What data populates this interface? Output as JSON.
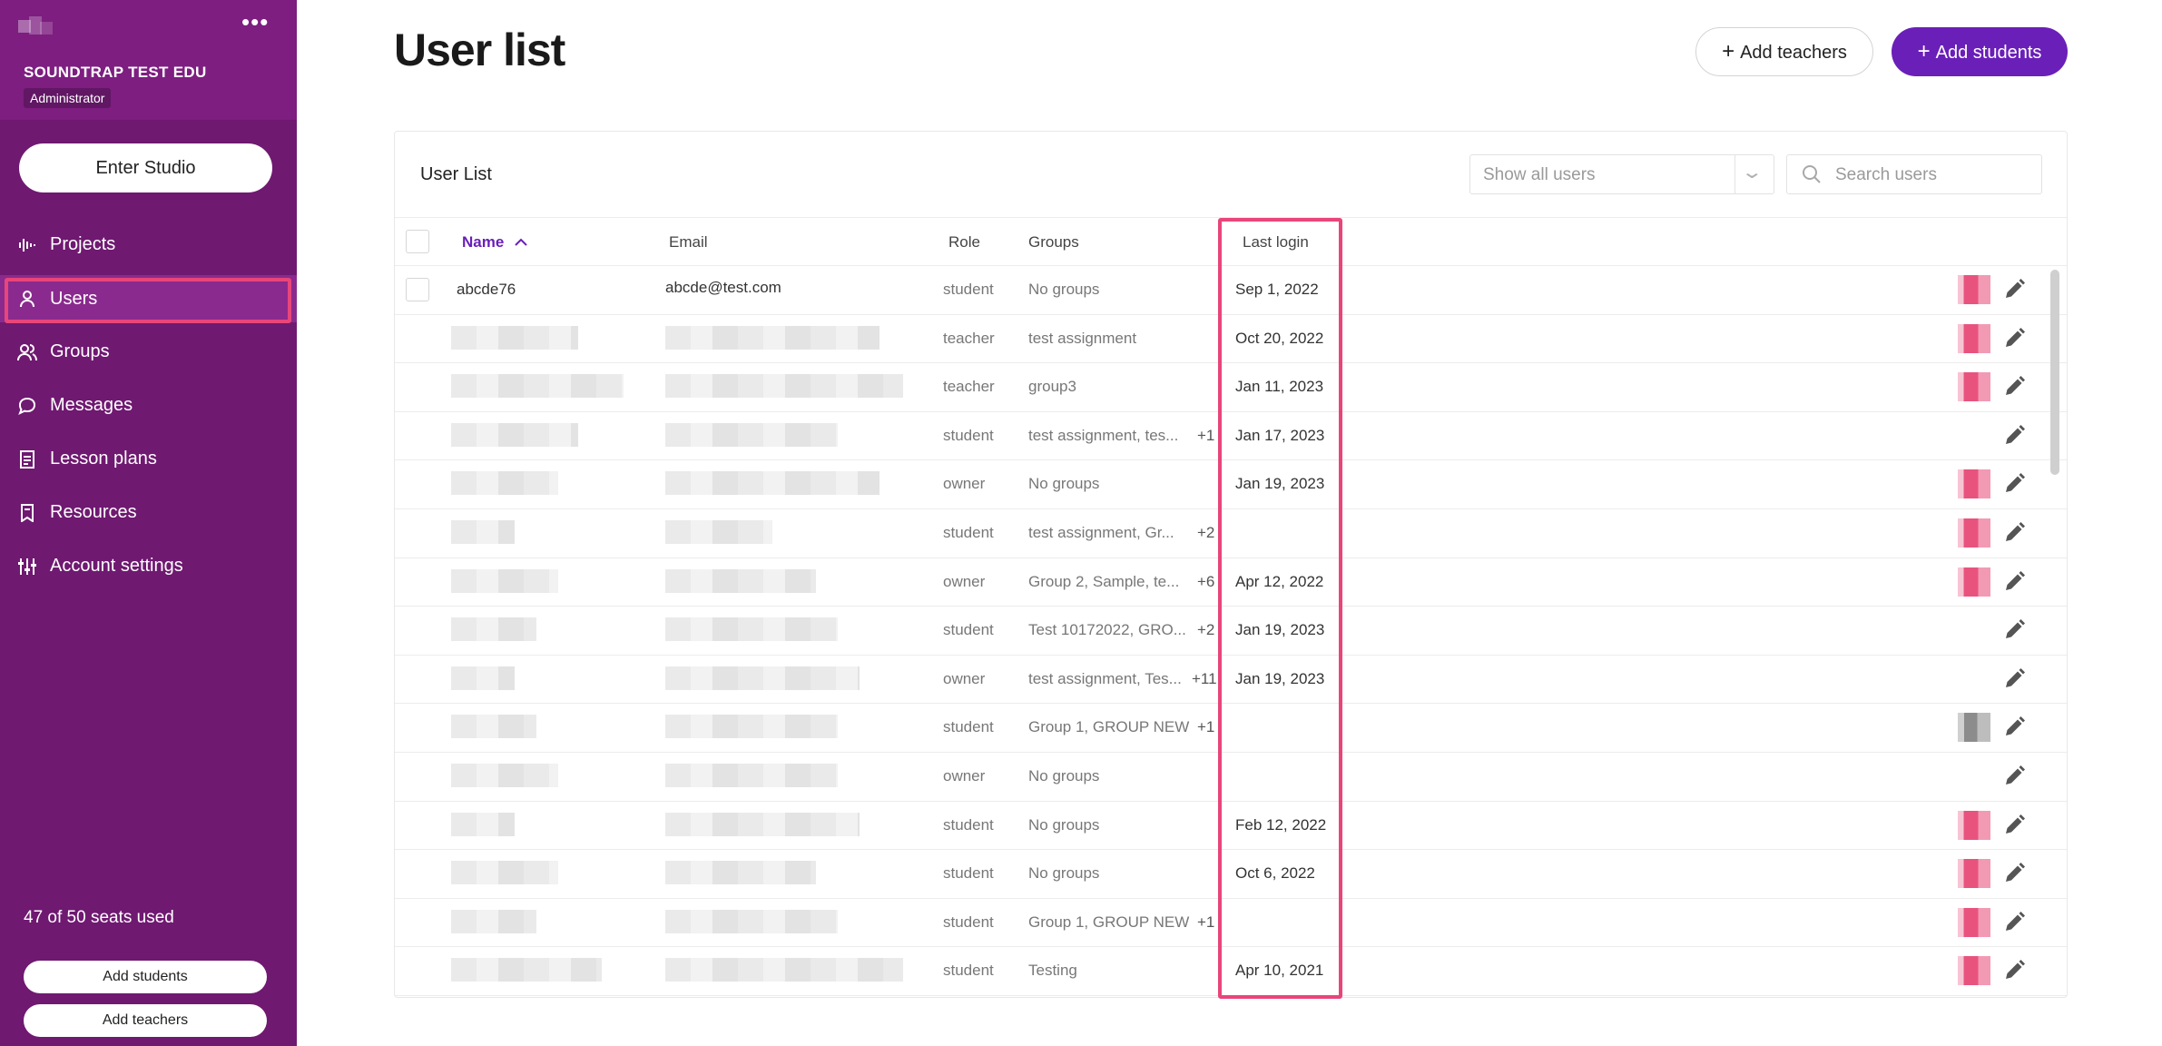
{
  "sidebar": {
    "org_name": "SOUNDTRAP TEST EDU",
    "role": "Administrator",
    "enter_studio": "Enter Studio",
    "nav": [
      {
        "label": "Projects",
        "icon": "bars-icon"
      },
      {
        "label": "Users",
        "icon": "user-icon",
        "active": true
      },
      {
        "label": "Groups",
        "icon": "group-icon"
      },
      {
        "label": "Messages",
        "icon": "chat-icon"
      },
      {
        "label": "Lesson plans",
        "icon": "document-icon"
      },
      {
        "label": "Resources",
        "icon": "bookmark-icon"
      },
      {
        "label": "Account settings",
        "icon": "sliders-icon"
      }
    ],
    "seats": "47 of 50 seats used",
    "add_students": "Add students",
    "add_teachers": "Add teachers"
  },
  "header": {
    "title": "User list",
    "add_teachers": "Add teachers",
    "add_students": "Add students"
  },
  "card": {
    "title": "User List",
    "filter": "Show all users",
    "search_placeholder": "Search users"
  },
  "table": {
    "columns": {
      "name": "Name",
      "email": "Email",
      "role": "Role",
      "groups": "Groups",
      "last_login": "Last login"
    },
    "rows": [
      {
        "name": "abcde76",
        "email": "abcde@test.com",
        "role": "student",
        "groups": "No groups",
        "more": "",
        "last_login": "Sep 1, 2022",
        "avatar": "pink"
      },
      {
        "name": "",
        "email": "",
        "role": "teacher",
        "groups": "test assignment",
        "more": "",
        "last_login": "Oct 20, 2022",
        "avatar": "pink"
      },
      {
        "name": "",
        "email": "",
        "role": "teacher",
        "groups": "group3",
        "more": "",
        "last_login": "Jan 11, 2023",
        "avatar": "pink"
      },
      {
        "name": "",
        "email": "",
        "role": "student",
        "groups": "test assignment, tes...",
        "more": "+1",
        "last_login": "Jan 17, 2023",
        "avatar": ""
      },
      {
        "name": "",
        "email": "",
        "role": "owner",
        "groups": "No groups",
        "more": "",
        "last_login": "Jan 19, 2023",
        "avatar": "pink"
      },
      {
        "name": "",
        "email": "",
        "role": "student",
        "groups": "test assignment, Gr...",
        "more": "+2",
        "last_login": "",
        "avatar": "pink"
      },
      {
        "name": "",
        "email": "",
        "role": "owner",
        "groups": "Group 2, Sample, te...",
        "more": "+6",
        "last_login": "Apr 12, 2022",
        "avatar": "pink"
      },
      {
        "name": "",
        "email": "",
        "role": "student",
        "groups": "Test 10172022, GRO...",
        "more": "+2",
        "last_login": "Jan 19, 2023",
        "avatar": ""
      },
      {
        "name": "",
        "email": "",
        "role": "owner",
        "groups": "test assignment, Tes...",
        "more": "+11",
        "last_login": "Jan 19, 2023",
        "avatar": ""
      },
      {
        "name": "",
        "email": "",
        "role": "student",
        "groups": "Group 1, GROUP NEW",
        "more": "+1",
        "last_login": "",
        "avatar": "grey"
      },
      {
        "name": "",
        "email": "",
        "role": "owner",
        "groups": "No groups",
        "more": "",
        "last_login": "",
        "avatar": ""
      },
      {
        "name": "",
        "email": "",
        "role": "student",
        "groups": "No groups",
        "more": "",
        "last_login": "Feb 12, 2022",
        "avatar": "pink"
      },
      {
        "name": "",
        "email": "",
        "role": "student",
        "groups": "No groups",
        "more": "",
        "last_login": "Oct 6, 2022",
        "avatar": "pink"
      },
      {
        "name": "",
        "email": "",
        "role": "student",
        "groups": "Group 1, GROUP NEW",
        "more": "+1",
        "last_login": "",
        "avatar": "pink"
      },
      {
        "name": "",
        "email": "",
        "role": "student",
        "groups": "Testing",
        "more": "",
        "last_login": "Apr 10, 2021",
        "avatar": "pink"
      }
    ]
  },
  "colors": {
    "sidebar": "#6f1971",
    "accent": "#6a1fb8",
    "highlight": "#e8457a"
  }
}
